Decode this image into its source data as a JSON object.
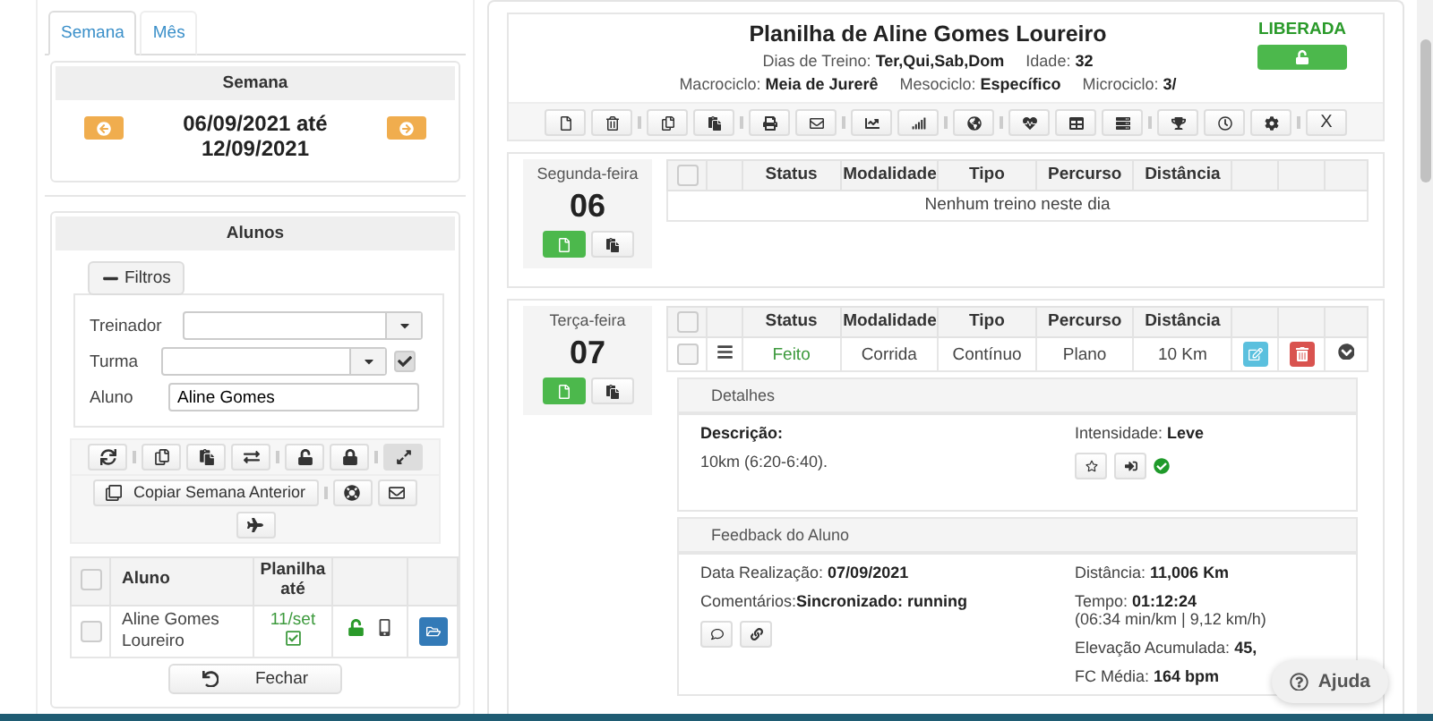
{
  "tabs": [
    {
      "label": "Semana",
      "selected": true
    },
    {
      "label": "Mês",
      "selected": false
    }
  ],
  "week": {
    "title": "Semana",
    "range": "06/09/2021 até 12/09/2021"
  },
  "students": {
    "title": "Alunos",
    "filter_toggle": "Filtros",
    "filters": [
      {
        "kind": "select",
        "label": "Treinador"
      },
      {
        "kind": "select_check",
        "label": "Turma",
        "checked": true
      },
      {
        "kind": "text",
        "label": "Aluno",
        "value": "Aline Gomes"
      }
    ],
    "copy_button": "Copiar Semana Anterior",
    "columns": [
      "Aluno",
      "Planilha até"
    ],
    "all_checked": false,
    "rows": [
      {
        "name": "Aline Gomes Loureiro",
        "until": "11/set",
        "checked": false
      }
    ],
    "close_button": "Fechar"
  },
  "sheet": {
    "title": "Planilha de Aline Gomes Loureiro",
    "status": "LIBERADA",
    "info": [
      [
        "Dias de Treino: **Ter,Qui,Sab,Dom**",
        "Idade: **32**"
      ],
      [
        "Macrociclo: **Meia de Jurerê**",
        "Mesociclo: **Específico**",
        "Microciclo: **3/**"
      ]
    ],
    "close_label": "X"
  },
  "days": [
    {
      "name": "Segunda-feira",
      "number": "06",
      "columns": [
        "Status",
        "Modalidade",
        "Tipo",
        "Percurso",
        "Distância"
      ],
      "all_checked": false,
      "empty": "Nenhum treino neste dia"
    },
    {
      "name": "Terça-feira",
      "number": "07",
      "columns": [
        "Status",
        "Modalidade",
        "Tipo",
        "Percurso",
        "Distância"
      ],
      "all_checked": false,
      "rows": [
        {
          "checked": false,
          "cells": [
            "Feito",
            "Corrida",
            "Contínuo",
            "Plano",
            "10 Km"
          ]
        }
      ],
      "details": {
        "title": "Detalhes",
        "description_label": "Descrição:",
        "description": "10km (6:20-6:40).",
        "intensity": "Intensidade: **Leve**"
      },
      "feedback": {
        "title": "Feedback do Aluno",
        "left": [
          "Data Realização: **07/09/2021**",
          "Comentários:**Sincronizado: running**"
        ],
        "right": [
          {
            "text": "Distância: **11,006 Km**"
          },
          {
            "text": "Tempo: **01:12:24**",
            "note": "(06:34 min/km | 9,12 km/h)"
          },
          {
            "text": "Elevação Acumulada: **45,**"
          },
          {
            "text": "FC Média: **164 bpm**"
          }
        ]
      }
    }
  ],
  "help": "Ajuda"
}
